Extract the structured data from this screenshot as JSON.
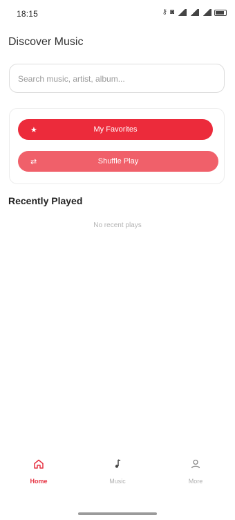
{
  "status_bar": {
    "time": "18:15"
  },
  "header": {
    "title": "Discover Music"
  },
  "search": {
    "placeholder": "Search music, artist, album..."
  },
  "quick_actions": {
    "favorites_label": "My Favorites",
    "shuffle_label": "Shuffle Play"
  },
  "recent": {
    "title": "Recently Played",
    "empty_text": "No recent plays"
  },
  "bottom_nav": {
    "items": [
      {
        "label": "Home",
        "icon": "home-icon",
        "active": true
      },
      {
        "label": "Music",
        "icon": "music-note-icon",
        "active": false
      },
      {
        "label": "More",
        "icon": "person-icon",
        "active": false
      }
    ]
  },
  "colors": {
    "accent": "#ec2b3b",
    "accent_light": "#f0606a",
    "nav_active": "#e63343",
    "nav_inactive": "#b0b0b0"
  }
}
